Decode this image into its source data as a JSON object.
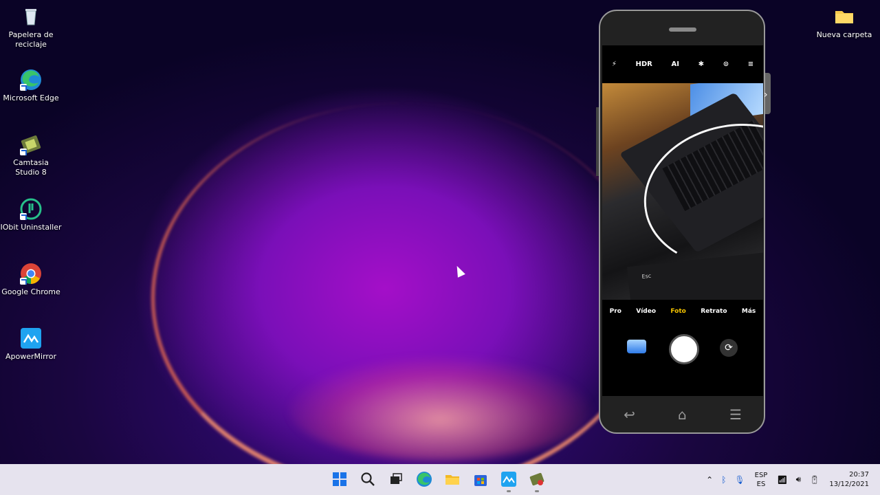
{
  "desktop": {
    "icons": [
      {
        "label": "Papelera de reciclaje",
        "icon": "recycle-bin-icon"
      },
      {
        "label": "Microsoft Edge",
        "icon": "edge-icon"
      },
      {
        "label": "Camtasia Studio 8",
        "icon": "camtasia-icon"
      },
      {
        "label": "IObit Uninstaller",
        "icon": "iobit-icon"
      },
      {
        "label": "Google Chrome",
        "icon": "chrome-icon"
      },
      {
        "label": "ApowerMirror",
        "icon": "apowermirror-icon"
      }
    ],
    "folder": {
      "label": "Nueva carpeta",
      "icon": "folder-icon"
    }
  },
  "phone": {
    "camera_toolbar": [
      "flash-off-icon",
      "HDR",
      "AI",
      "filter-off-icon",
      "lens-icon",
      "menu-icon"
    ],
    "camera_toolbar_labels": {
      "hdr": "HDR",
      "ai": "AI"
    },
    "viewfinder_label": "Esc",
    "modes": [
      "Pro",
      "Vídeo",
      "Foto",
      "Retrato",
      "Más"
    ],
    "active_mode": "Foto"
  },
  "taskbar": {
    "apps": [
      "start-icon",
      "search-icon",
      "task-view-icon",
      "edge-icon",
      "file-explorer-icon",
      "store-icon",
      "apowermirror-icon",
      "camtasia-icon"
    ],
    "language": {
      "line1": "ESP",
      "line2": "ES"
    },
    "clock": {
      "time": "20:37",
      "date": "13/12/2021"
    }
  },
  "colors": {
    "accent": "#f5c400",
    "taskbar": "#e6e3ee"
  }
}
